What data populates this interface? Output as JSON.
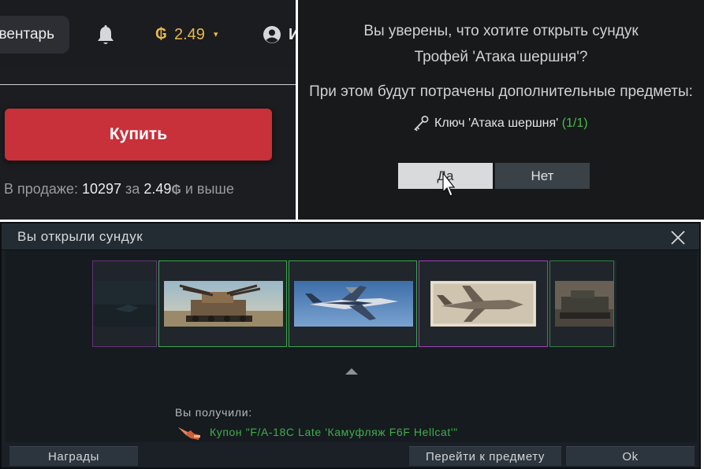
{
  "market": {
    "inventory_label": "вентарь",
    "balance": "2.49",
    "balance_currency_icon": "gaijin-coin-icon",
    "user_initial": "И",
    "buy_label": "Купить",
    "on_sale_label": "В продаже:",
    "on_sale_count": "10297",
    "for_label": "за",
    "price": "2.49",
    "price_suffix": "и выше",
    "colors": {
      "buy_button": "#c8303a",
      "balance": "#e8b94a"
    }
  },
  "confirm_dialog": {
    "question_line1": "Вы уверены, что хотите открыть сундук",
    "question_line2": "Трофей 'Атака шершня'?",
    "extra_items_label": "При этом будут потрачены дополнительные предметы:",
    "key_name": "Ключ 'Атака шершня'",
    "key_count": "(1/1)",
    "yes_label": "Да",
    "no_label": "Нет",
    "colors": {
      "key_count": "#4cbb4c"
    }
  },
  "chest_dialog": {
    "title": "Вы открыли сундук",
    "received_label": "Вы получили:",
    "reward_name": "Купон \"F/A-18C Late 'Камуфляж F6F Hellcat'\"",
    "cards": [
      {
        "name": "unknown-item",
        "rarity_color": "#a040b8"
      },
      {
        "name": "anti-air-tank-camo",
        "rarity_color": "#3aa84a"
      },
      {
        "name": "fa-18c-camo",
        "rarity_color": "#3aa84a"
      },
      {
        "name": "vintage-jet-camo",
        "rarity_color": "#a040b8"
      },
      {
        "name": "tank-camo",
        "rarity_color": "#3aa84a"
      }
    ],
    "rewards_button": "Награды",
    "goto_item_button": "Перейти к предмету",
    "ok_button": "Ok",
    "colors": {
      "reward_text": "#3fae4a"
    }
  }
}
